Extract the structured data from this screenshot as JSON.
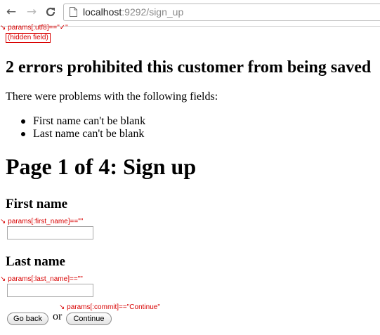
{
  "browser": {
    "back_icon": "←",
    "forward_icon": "→",
    "reload_icon": "C",
    "url_host": "localhost",
    "url_rest": ":9292/sign_up"
  },
  "annotations": {
    "utf8": "↘ params[:utf8]==\"✓\"",
    "hidden_field": "(hidden field)",
    "first_name": "↘ params[:first_name]==\"\"",
    "last_name": "↘ params[:last_name]==\"\"",
    "commit": "↘ params[:commit]==\"Continue\""
  },
  "errors": {
    "title": "2 errors prohibited this customer from being saved",
    "intro": "There were problems with the following fields:",
    "items": [
      "First name can't be blank",
      "Last name can't be blank"
    ]
  },
  "page_title": "Page 1 of 4: Sign up",
  "form": {
    "first_name_label": "First name",
    "first_name_value": "",
    "last_name_label": "Last name",
    "last_name_value": "",
    "back_button": "Go back",
    "or_text": "or",
    "continue_button": "Continue"
  },
  "colors": {
    "annotation": "#d80000"
  }
}
